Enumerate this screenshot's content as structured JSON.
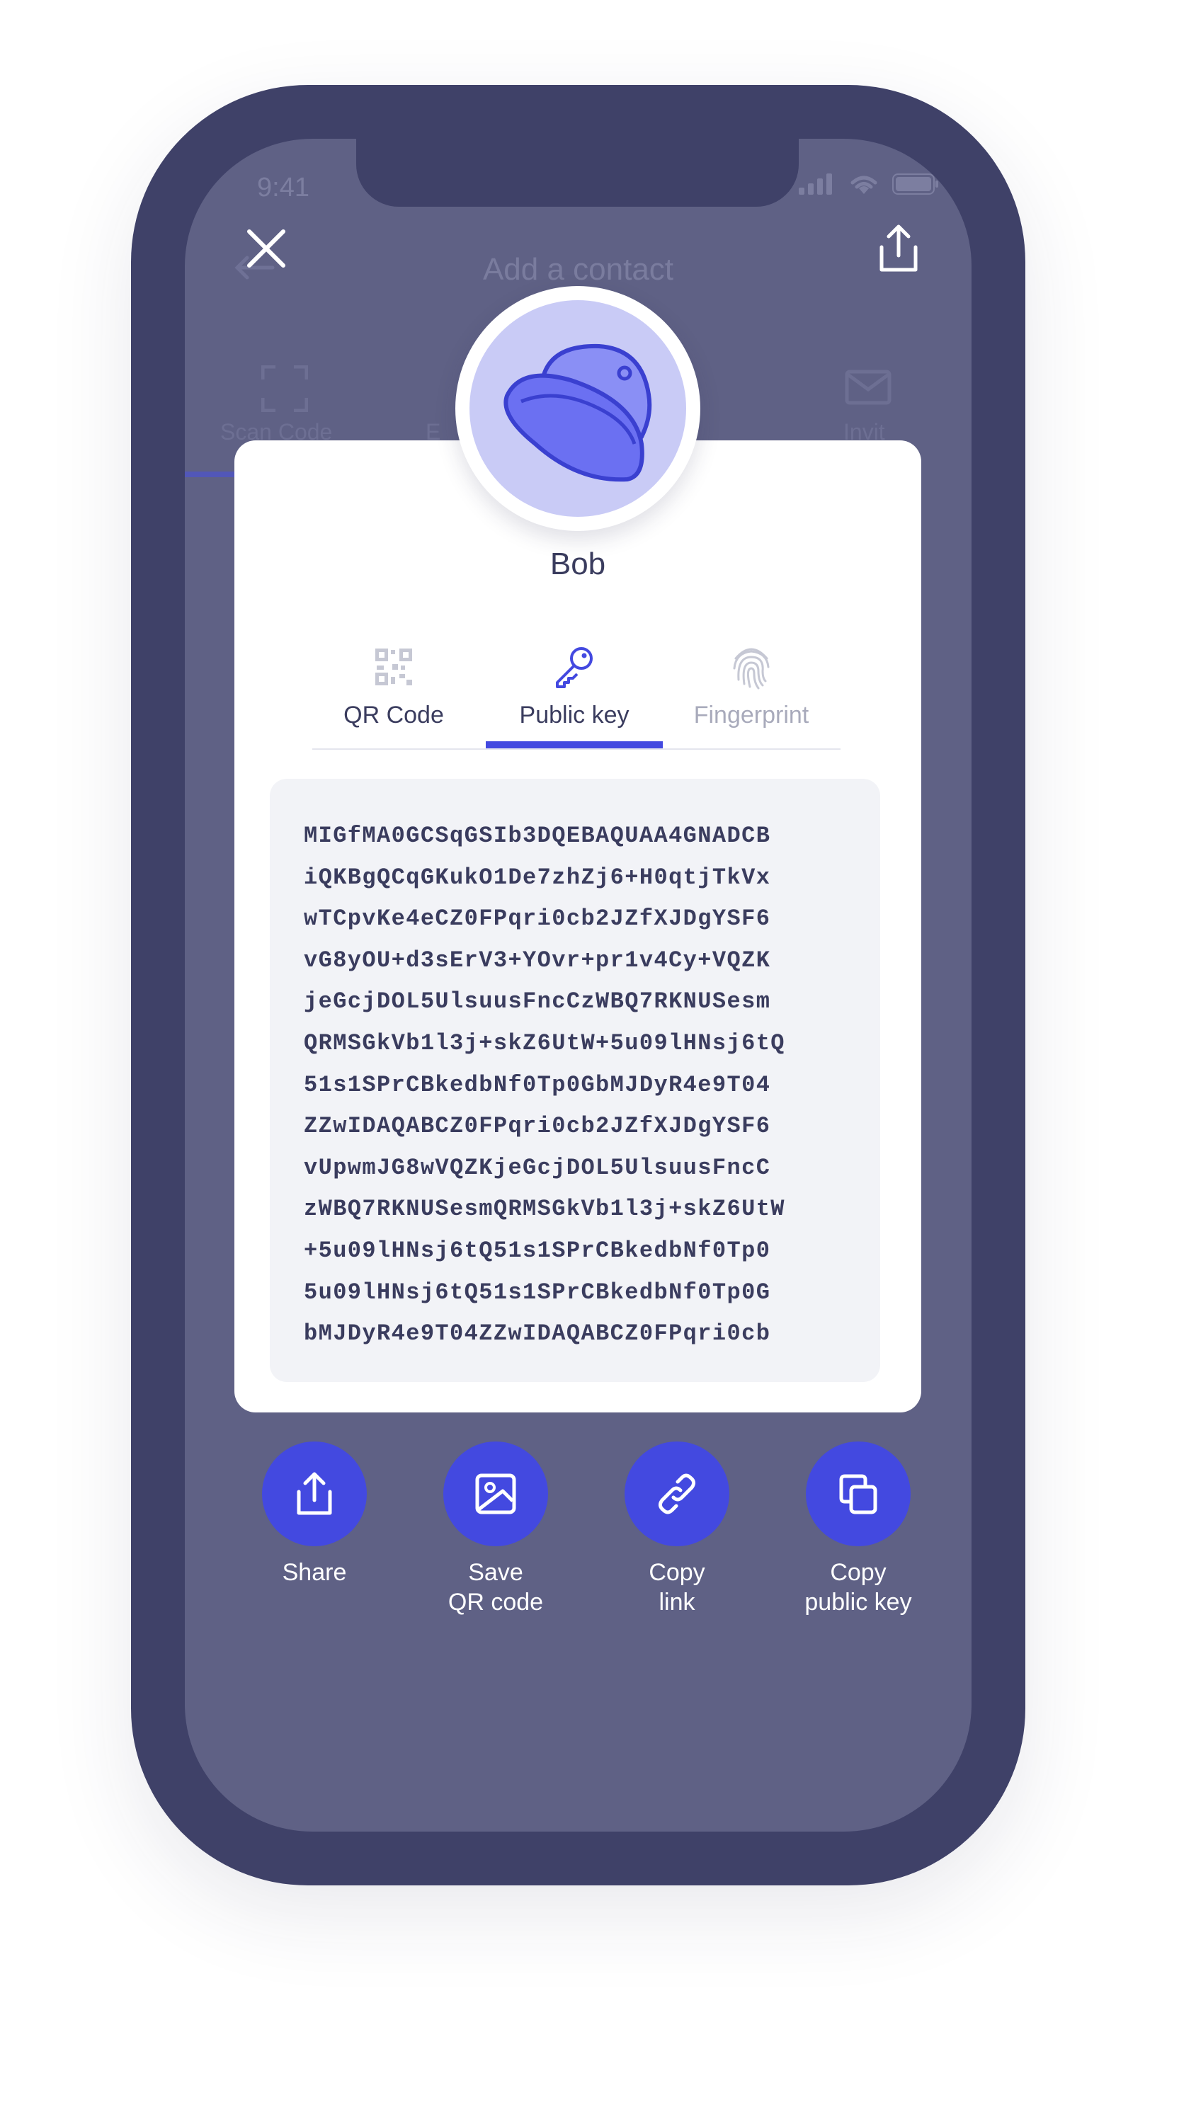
{
  "status_bar": {
    "time": "9:41"
  },
  "background": {
    "title": "Add a contact",
    "tabs": [
      "Scan Code",
      "E",
      "",
      "Invit"
    ]
  },
  "contact": {
    "name": "Bob"
  },
  "tabs": [
    {
      "label": "QR Code",
      "icon": "qr-code-icon",
      "state": "inactive"
    },
    {
      "label": "Public key",
      "icon": "key-icon",
      "state": "active"
    },
    {
      "label": "Fingerprint",
      "icon": "fingerprint-icon",
      "state": "disabled"
    }
  ],
  "public_key": "MIGfMA0GCSqGSIb3DQEBAQUAA4GNADCB\niQKBgQCqGKukO1De7zhZj6+H0qtjTkVx\nwTCpvKe4eCZ0FPqri0cb2JZfXJDgYSF6\nvG8yOU+d3sErV3+YOvr+pr1v4Cy+VQZK\njeGcjDOL5UlsuusFncCzWBQ7RKNUSesm\nQRMSGkVb1l3j+skZ6UtW+5u09lHNsj6tQ\n51s1SPrCBkedbNf0Tp0GbMJDyR4e9T04\nZZwIDAQABCZ0FPqri0cb2JZfXJDgYSF6\nvUpwmJG8wVQZKjeGcjDOL5UlsuusFncC\nzWBQ7RKNUSesmQRMSGkVb1l3j+skZ6UtW\n+5u09lHNsj6tQ51s1SPrCBkedbNf0Tp0\n5u09lHNsj6tQ51s1SPrCBkedbNf0Tp0G\nbMJDyR4e9T04ZZwIDAQABCZ0FPqri0cb",
  "actions": [
    {
      "label": "Share",
      "icon": "share-icon"
    },
    {
      "label": "Save\nQR code",
      "icon": "image-icon"
    },
    {
      "label": "Copy\nlink",
      "icon": "link-icon"
    },
    {
      "label": "Copy\npublic key",
      "icon": "copy-icon"
    }
  ],
  "colors": {
    "accent": "#4349e0",
    "phone_frame": "#3f4168",
    "screen_overlay": "#5f6185",
    "avatar_bg": "#c9cbf6"
  }
}
